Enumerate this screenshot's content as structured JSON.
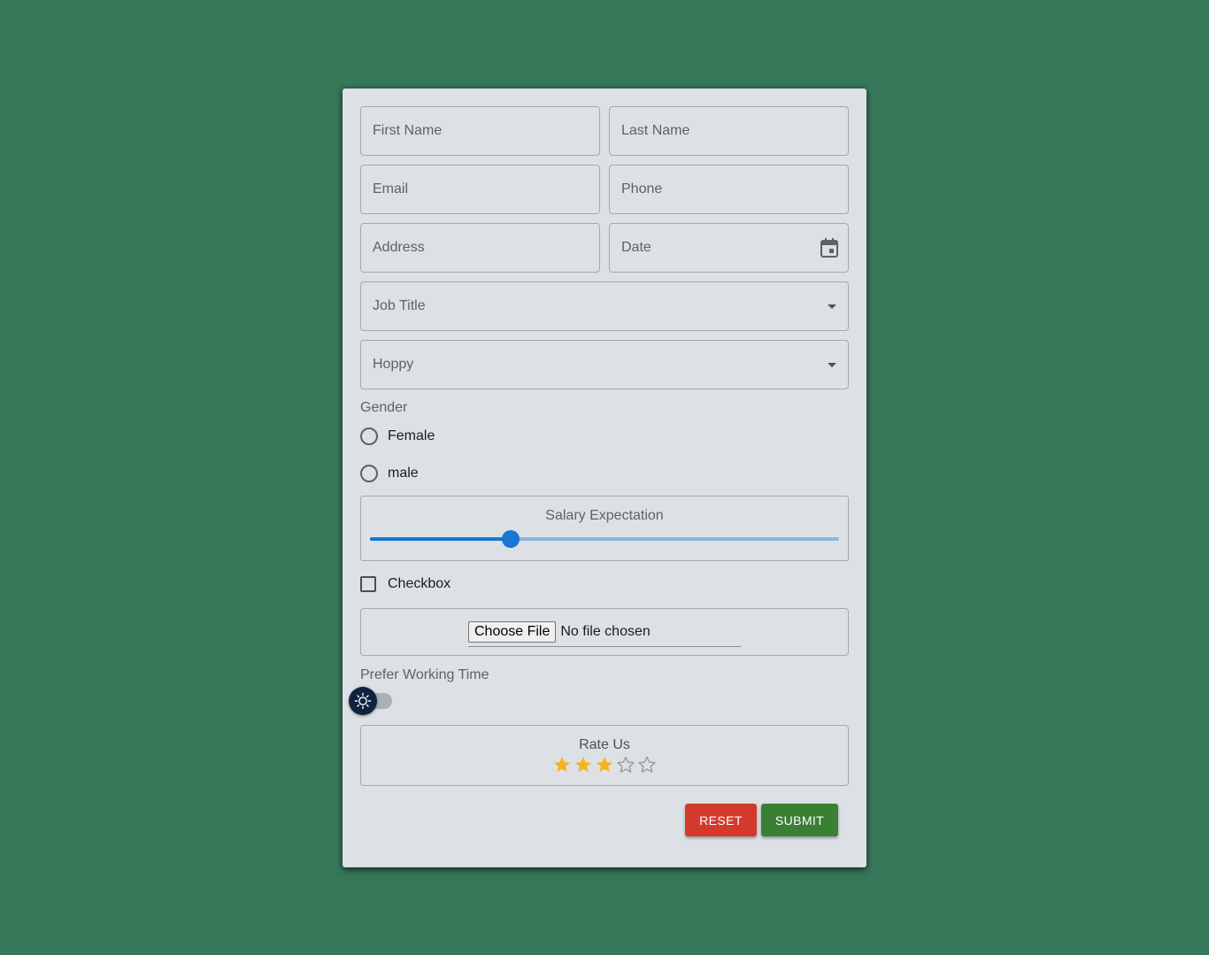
{
  "fields": {
    "first_name": {
      "placeholder": "First Name",
      "value": ""
    },
    "last_name": {
      "placeholder": "Last Name",
      "value": ""
    },
    "email": {
      "placeholder": "Email",
      "value": ""
    },
    "phone": {
      "placeholder": "Phone",
      "value": ""
    },
    "address": {
      "placeholder": "Address",
      "value": ""
    },
    "date": {
      "placeholder": "Date",
      "value": ""
    }
  },
  "selects": {
    "job_title": {
      "label": "Job Title",
      "icon": "caret-down-icon"
    },
    "hobby": {
      "label": "Hoppy",
      "icon": "caret-down-icon"
    }
  },
  "gender": {
    "label": "Gender",
    "options": [
      "Female",
      "male"
    ],
    "selected": null
  },
  "salary": {
    "label": "Salary Expectation",
    "value_fraction": 0.3
  },
  "checkbox": {
    "label": "Checkbox",
    "checked": false
  },
  "file": {
    "button_label": "Choose File",
    "status": "No file chosen"
  },
  "working_time": {
    "label": "Prefer Working Time",
    "toggle_on": false,
    "icon": "sun-icon"
  },
  "rating": {
    "label": "Rate Us",
    "value": 3,
    "max": 5
  },
  "buttons": {
    "reset": "RESET",
    "submit": "SUBMIT"
  },
  "colors": {
    "background": "#37775a",
    "card": "#dde1e5",
    "accent": "#1976d2",
    "reset": "#d33a2c",
    "submit": "#3a7f34",
    "star_filled": "#f6b31c",
    "star_empty": "#9a9da0"
  }
}
